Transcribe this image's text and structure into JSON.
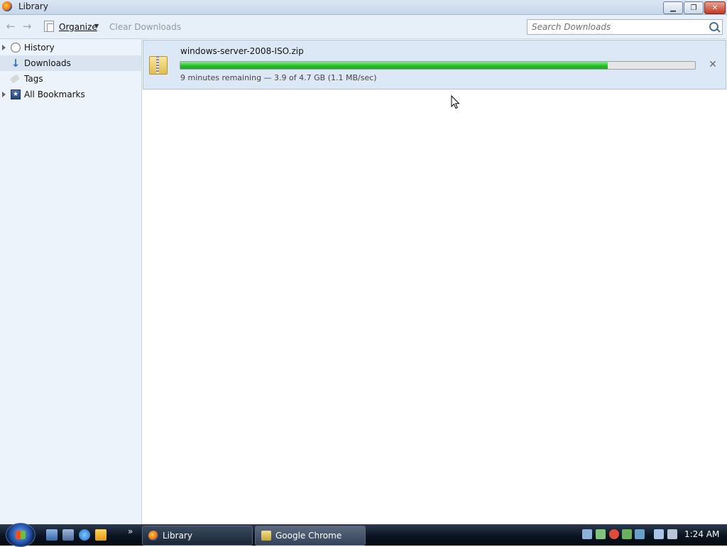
{
  "window": {
    "title": "Library"
  },
  "toolbar": {
    "back_icon": "back-arrow-icon",
    "forward_icon": "forward-arrow-icon",
    "organize_label": "Organize",
    "clear_label": "Clear Downloads",
    "search_placeholder": "Search Downloads"
  },
  "sidebar": {
    "items": [
      {
        "label": "History",
        "icon": "clock-icon",
        "expandable": true,
        "selected": false
      },
      {
        "label": "Downloads",
        "icon": "download-arrow-icon",
        "expandable": false,
        "selected": true
      },
      {
        "label": "Tags",
        "icon": "tag-icon",
        "expandable": false,
        "selected": false
      },
      {
        "label": "All Bookmarks",
        "icon": "bookmarks-star-icon",
        "expandable": true,
        "selected": false
      }
    ]
  },
  "downloads": [
    {
      "filename": "windows-server-2008-ISO.zip",
      "progress": 0.83,
      "status": "9 minutes remaining — 3.9 of 4.7 GB (1.1 MB/sec)"
    }
  ],
  "taskbar": {
    "tasks": [
      {
        "label": "Library",
        "active": true
      },
      {
        "label": "Google Chrome",
        "active": false
      }
    ],
    "clock": "1:24 AM"
  },
  "colors": {
    "progress": "#1dbe21",
    "selection": "#d9e4f0",
    "download_item_bg": "#dce8f5"
  }
}
